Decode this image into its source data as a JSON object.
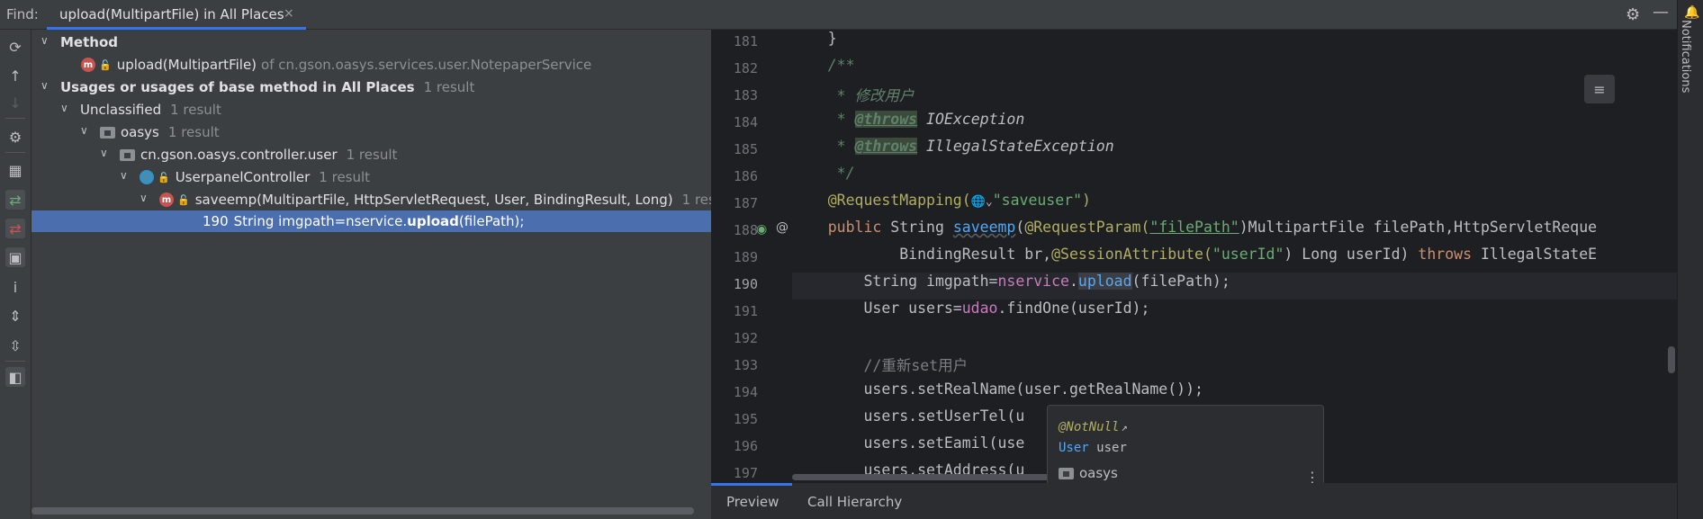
{
  "header": {
    "find_label": "Find:",
    "tab_title": "upload(MultipartFile) in All Places",
    "tab_close": "×",
    "settings_icon": "gear-icon",
    "minimize_icon": "minimize-icon"
  },
  "tree": {
    "method_label": "Method",
    "method_name": "upload(MultipartFile)",
    "method_of": "of cn.gson.oasys.services.user.NotepaperService",
    "usages_label": "Usages or usages of base method in All Places",
    "usages_count": "1 result",
    "unclassified_label": "Unclassified",
    "unclassified_count": "1 result",
    "module_label": "oasys",
    "module_count": "1 result",
    "package_label": "cn.gson.oasys.controller.user",
    "package_count": "1 result",
    "class_label": "UserpanelController",
    "class_count": "1 result",
    "method_usage_label": "saveemp(MultipartFile, HttpServletRequest, User, BindingResult, Long)",
    "method_usage_count": "1 resu",
    "line_number": "190",
    "line_pre": "String imgpath=nservice.",
    "line_bold": "upload",
    "line_post": "(filePath);"
  },
  "editor": {
    "line_numbers": [
      "181",
      "182",
      "183",
      "184",
      "185",
      "186",
      "187",
      "188",
      "189",
      "190",
      "191",
      "192",
      "193",
      "194",
      "195",
      "196",
      "197"
    ],
    "l181": "    }",
    "l182": "    /**",
    "l183_star": "     * ",
    "l183_text": "修改用户",
    "l184_star": "     * ",
    "l184_tag": "@throws",
    "l184_rest": " IOException",
    "l185_star": "     * ",
    "l185_tag": "@throws",
    "l185_rest": " IllegalStateException",
    "l186": "     */",
    "l187_ann": "    @RequestMapping(",
    "l187_icon": "🌐⌄",
    "l187_str": "\"saveuser\"",
    "l187_end": ")",
    "l188_k": "    public ",
    "l188_t": "String ",
    "l188_fn": "saveemp",
    "l188_p": "(",
    "l188_ann": "@RequestParam(",
    "l188_str": "\"filePath\"",
    "l188_rest": ")MultipartFile filePath,HttpServletReque",
    "l189_pre": "            BindingResult br,",
    "l189_ann": "@SessionAttribute(",
    "l189_str": "\"userId\"",
    "l189_mid": ") Long userId) ",
    "l189_k": "throws",
    "l189_rest": " IllegalStateE",
    "l190_pre": "        String imgpath=",
    "l190_fld": "nservice",
    "l190_dot": ".",
    "l190_fn": "upload",
    "l190_rest": "(filePath);",
    "l191_pre": "        User users=",
    "l191_fld": "udao",
    "l191_rest": ".findOne(userId);",
    "l193": "        //重新set用户",
    "l194": "        users.setRealName(user.getRealName());",
    "l195": "        users.setUserTel(u",
    "l196": "        users.setEamil(use",
    "l197": "        users.setAddress(u"
  },
  "popup": {
    "annotation": "@NotNull",
    "arrow": "↗",
    "type": "User",
    "var": "user",
    "module": "oasys"
  },
  "bottom_tabs": {
    "preview": "Preview",
    "call_hierarchy": "Call Hierarchy"
  },
  "right_strip": {
    "notifications": "Notifications"
  }
}
